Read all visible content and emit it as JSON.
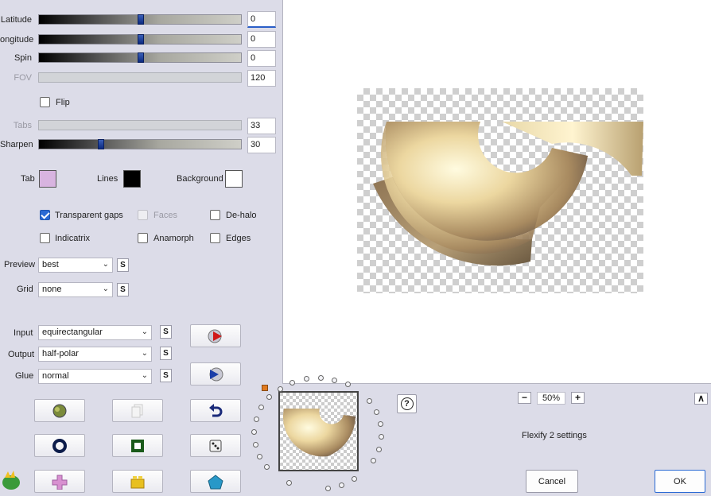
{
  "sliders": {
    "latitude": {
      "label": "Latitude",
      "value": "0",
      "level": 0.5
    },
    "longitude": {
      "label": "ongitude",
      "value": "0",
      "level": 0.5
    },
    "spin": {
      "label": "Spin",
      "value": "0",
      "level": 0.5
    },
    "fov": {
      "label": "FOV",
      "value": "120"
    },
    "tabs": {
      "label": "Tabs",
      "value": "33"
    },
    "sharpen": {
      "label": "Sharpen",
      "value": "30",
      "level": 0.3
    }
  },
  "flip": {
    "label": "Flip",
    "checked": false
  },
  "colors": {
    "tab_label": "Tab",
    "tab_color": "#d8b4e0",
    "lines_label": "Lines",
    "lines_color": "#000000",
    "background_label": "Background",
    "background_color": "#ffffff"
  },
  "options": {
    "transparent_gaps": {
      "label": "Transparent gaps",
      "checked": true
    },
    "faces": {
      "label": "Faces",
      "checked": false
    },
    "de_halo": {
      "label": "De-halo",
      "checked": false
    },
    "indicatrix": {
      "label": "Indicatrix",
      "checked": false
    },
    "anamorph": {
      "label": "Anamorph",
      "checked": false
    },
    "edges": {
      "label": "Edges",
      "checked": false
    }
  },
  "selects": {
    "preview": {
      "label": "Preview",
      "value": "best"
    },
    "grid": {
      "label": "Grid",
      "value": "none"
    },
    "input": {
      "label": "Input",
      "value": "equirectangular"
    },
    "output": {
      "label": "Output",
      "value": "half-polar"
    },
    "glue": {
      "label": "Glue",
      "value": "normal"
    },
    "s_label": "S"
  },
  "zoom": {
    "minus": "−",
    "value": "50%",
    "plus": "+"
  },
  "settings_title": "Flexify 2 settings",
  "help": "?",
  "collapse": "∧",
  "buttons": {
    "cancel": "Cancel",
    "ok": "OK"
  },
  "accent": "#2a6ad4"
}
